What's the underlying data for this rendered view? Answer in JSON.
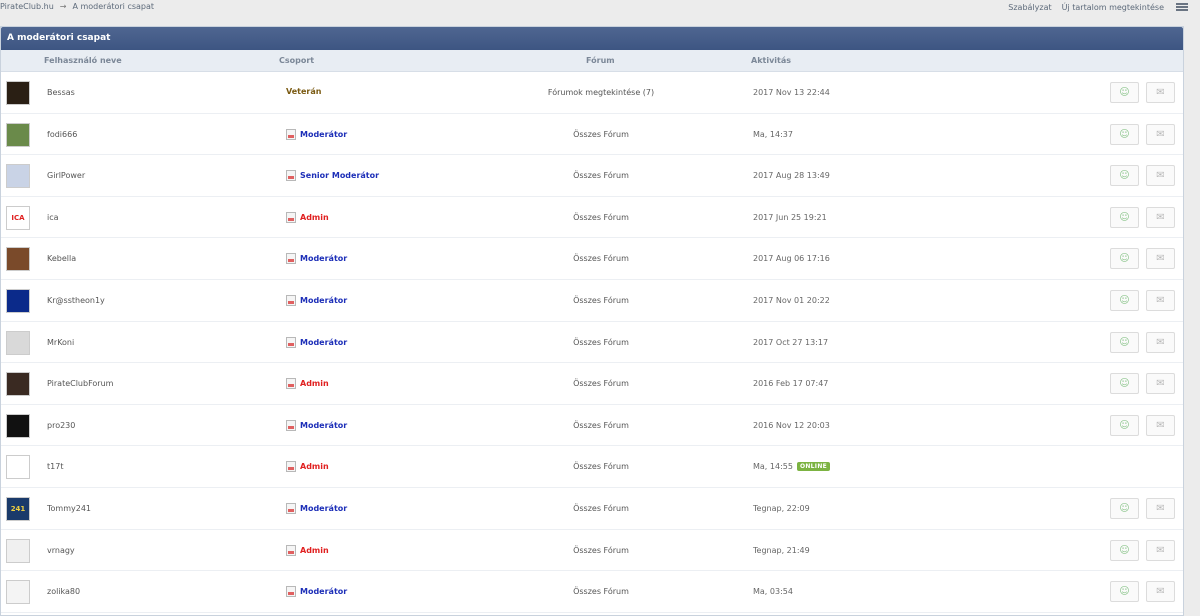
{
  "breadcrumb": {
    "home": "PirateClub.hu",
    "separator": "→",
    "current": "A moderátori csapat"
  },
  "toplinks": {
    "rules": "Szabályzat",
    "new_content": "Új tartalom megtekintése"
  },
  "panel": {
    "title": "A moderátori csapat"
  },
  "columns": {
    "user": "Felhasználó neve",
    "group": "Csoport",
    "forum": "Fórum",
    "activity": "Aktivitás"
  },
  "colors": {
    "veteran": "#7a5a12",
    "moderator": "#1d2fb8",
    "admin": "#e02020",
    "header": "#3d5582",
    "online": "#7cb342"
  },
  "rows": [
    {
      "name": "Bessas",
      "group": "Veterán",
      "group_type": "veteran",
      "forum": "Fórumok megtekintése (7)",
      "activity": "2017 Nov 13 22:44",
      "online": "",
      "avatar_color": "#2a1f14",
      "buttons": true
    },
    {
      "name": "fodi666",
      "group": "Moderátor",
      "group_type": "moderator",
      "forum": "Összes Fórum",
      "activity": "Ma, 14:37",
      "online": "",
      "avatar_color": "#6a8a4a",
      "buttons": true
    },
    {
      "name": "GirlPower",
      "group": "Senior Moderátor",
      "group_type": "moderator",
      "forum": "Összes Fórum",
      "activity": "2017 Aug 28 13:49",
      "online": "",
      "avatar_color": "#c9d3e6",
      "buttons": true
    },
    {
      "name": "ica",
      "group": "Admin",
      "group_type": "admin",
      "forum": "Összes Fórum",
      "activity": "2017 Jun 25 19:21",
      "online": "",
      "avatar_color": "#ffffff",
      "avatar_text": "ICA",
      "buttons": true
    },
    {
      "name": "Kebella",
      "group": "Moderátor",
      "group_type": "moderator",
      "forum": "Összes Fórum",
      "activity": "2017 Aug 06 17:16",
      "online": "",
      "avatar_color": "#7a4a2a",
      "buttons": true
    },
    {
      "name": "Kr@sstheon1y",
      "group": "Moderátor",
      "group_type": "moderator",
      "forum": "Összes Fórum",
      "activity": "2017 Nov 01 20:22",
      "online": "",
      "avatar_color": "#0b2a8a",
      "buttons": true
    },
    {
      "name": "MrKoni",
      "group": "Moderátor",
      "group_type": "moderator",
      "forum": "Összes Fórum",
      "activity": "2017 Oct 27 13:17",
      "online": "",
      "avatar_color": "#d9d9d9",
      "buttons": true
    },
    {
      "name": "PirateClubForum",
      "group": "Admin",
      "group_type": "admin",
      "forum": "Összes Fórum",
      "activity": "2016 Feb 17 07:47",
      "online": "",
      "avatar_color": "#3a2a22",
      "buttons": true
    },
    {
      "name": "pro230",
      "group": "Moderátor",
      "group_type": "moderator",
      "forum": "Összes Fórum",
      "activity": "2016 Nov 12 20:03",
      "online": "",
      "avatar_color": "#111111",
      "buttons": true
    },
    {
      "name": "t17t",
      "group": "Admin",
      "group_type": "admin",
      "forum": "Összes Fórum",
      "activity": "Ma, 14:55",
      "online": "ONLINE",
      "avatar_color": "#ffffff",
      "buttons": false
    },
    {
      "name": "Tommy241",
      "group": "Moderátor",
      "group_type": "moderator",
      "forum": "Összes Fórum",
      "activity": "Tegnap, 22:09",
      "online": "",
      "avatar_color": "#1a3a6a",
      "avatar_text": "241",
      "buttons": true
    },
    {
      "name": "vrnagy",
      "group": "Admin",
      "group_type": "admin",
      "forum": "Összes Fórum",
      "activity": "Tegnap, 21:49",
      "online": "",
      "avatar_color": "#f0f0f0",
      "buttons": true
    },
    {
      "name": "zolika80",
      "group": "Moderátor",
      "group_type": "moderator",
      "forum": "Összes Fórum",
      "activity": "Ma, 03:54",
      "online": "",
      "avatar_color": "#f4f4f4",
      "buttons": true
    }
  ]
}
